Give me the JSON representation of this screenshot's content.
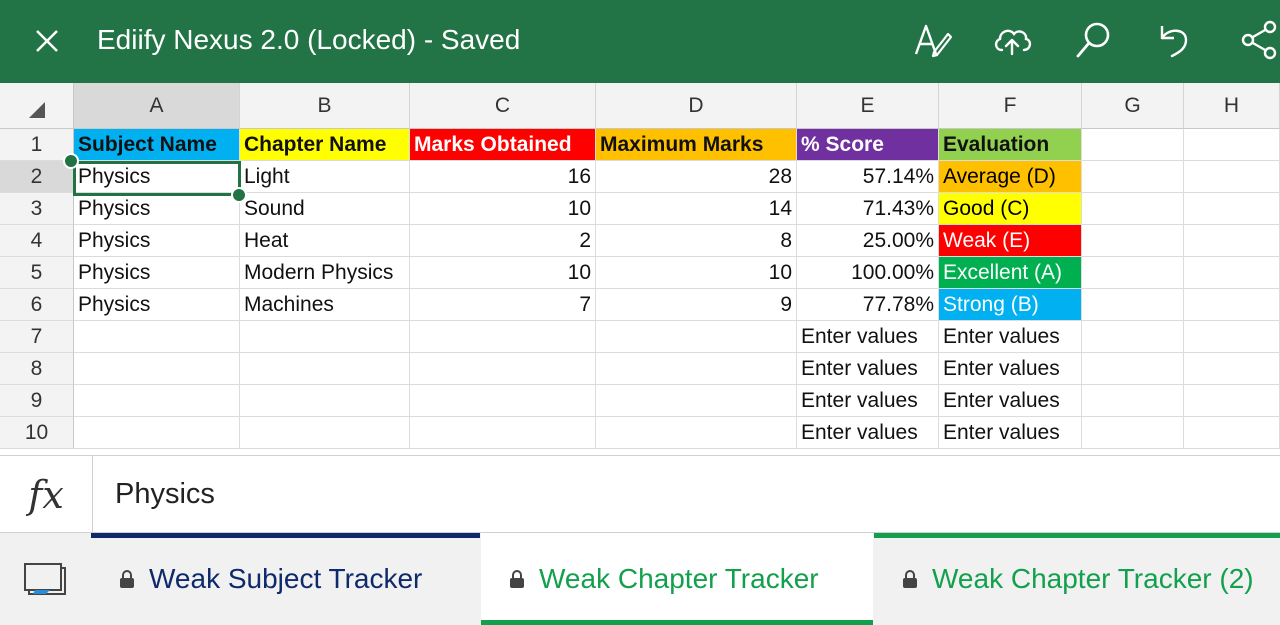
{
  "app": {
    "title": "Ediify Nexus 2.0 (Locked) - Saved",
    "icons": [
      "close-icon",
      "draw-icon",
      "cloud-upload-icon",
      "search-icon",
      "undo-icon",
      "share-icon"
    ],
    "accent_color": "#227446"
  },
  "grid": {
    "columns": [
      "A",
      "B",
      "C",
      "D",
      "E",
      "F",
      "G",
      "H"
    ],
    "rows": [
      "1",
      "2",
      "3",
      "4",
      "5",
      "6",
      "7",
      "8",
      "9",
      "10"
    ],
    "selected_cell": "A2",
    "header_row": {
      "subject": "Subject Name",
      "chapter": "Chapter Name",
      "marks": "Marks Obtained",
      "max": "Maximum Marks",
      "score": "% Score",
      "evaluation": "Evaluation"
    },
    "header_colors": {
      "subject": "#00b0f0",
      "chapter": "#ffff00",
      "marks": "#ff0000",
      "max": "#ffc000",
      "score": "#7030a0",
      "evaluation": "#92d050"
    },
    "data_rows": [
      {
        "subject": "Physics",
        "chapter": "Light",
        "marks": "16",
        "max": "28",
        "score": "57.14%",
        "evaluation": "Average (D)",
        "eval_color": "#ffc000",
        "eval_text_color": "#000000"
      },
      {
        "subject": "Physics",
        "chapter": "Sound",
        "marks": "10",
        "max": "14",
        "score": "71.43%",
        "evaluation": "Good (C)",
        "eval_color": "#ffff00",
        "eval_text_color": "#000000"
      },
      {
        "subject": "Physics",
        "chapter": "Heat",
        "marks": "2",
        "max": "8",
        "score": "25.00%",
        "evaluation": "Weak (E)",
        "eval_color": "#ff0000",
        "eval_text_color": "#ffffff"
      },
      {
        "subject": "Physics",
        "chapter": "Modern Physics",
        "marks": "10",
        "max": "10",
        "score": "100.00%",
        "evaluation": "Excellent (A)",
        "eval_color": "#00b050",
        "eval_text_color": "#ffffff"
      },
      {
        "subject": "Physics",
        "chapter": "Machines",
        "marks": "7",
        "max": "9",
        "score": "77.78%",
        "evaluation": "Strong (B)",
        "eval_color": "#00b0f0",
        "eval_text_color": "#ffffff"
      },
      {
        "subject": "",
        "chapter": "",
        "marks": "",
        "max": "",
        "score": "Enter values",
        "evaluation": "Enter values",
        "eval_color": "",
        "eval_text_color": "#111111"
      },
      {
        "subject": "",
        "chapter": "",
        "marks": "",
        "max": "",
        "score": "Enter values",
        "evaluation": "Enter values",
        "eval_color": "",
        "eval_text_color": "#111111"
      },
      {
        "subject": "",
        "chapter": "",
        "marks": "",
        "max": "",
        "score": "Enter values",
        "evaluation": "Enter values",
        "eval_color": "",
        "eval_text_color": "#111111"
      },
      {
        "subject": "",
        "chapter": "",
        "marks": "",
        "max": "",
        "score": "Enter values",
        "evaluation": "Enter values",
        "eval_color": "",
        "eval_text_color": "#111111"
      }
    ]
  },
  "formula_bar": {
    "fx_label": "fx",
    "value": "Physics"
  },
  "sheet_tabs": [
    {
      "label": "Weak Subject Tracker",
      "color": "#0f2a6b",
      "bar_color": "#0f2a6b",
      "active": false
    },
    {
      "label": "Weak Chapter Tracker",
      "color": "#13a04d",
      "bar_color": "#13a04d",
      "active": true
    },
    {
      "label": "Weak Chapter Tracker (2)",
      "color": "#13a04d",
      "bar_color": "#13a04d",
      "active": false
    }
  ]
}
